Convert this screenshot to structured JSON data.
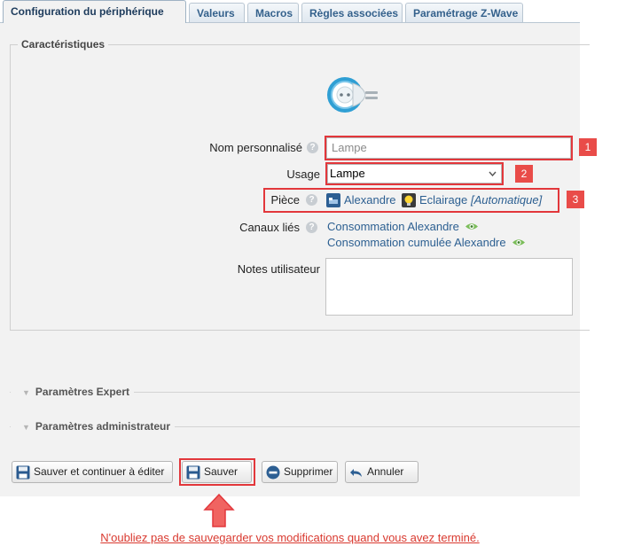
{
  "tabs": [
    {
      "label": "Configuration du périphérique",
      "active": true
    },
    {
      "label": "Valeurs"
    },
    {
      "label": "Macros"
    },
    {
      "label": "Règles associées"
    },
    {
      "label": "Paramétrage Z-Wave"
    }
  ],
  "characteristics": {
    "legend": "Caractéristiques",
    "device_icon": "plug-icon",
    "name": {
      "label": "Nom personnalisé",
      "value": "Lampe",
      "help": "?"
    },
    "usage": {
      "label": "Usage",
      "selected": "Lampe"
    },
    "room": {
      "label": "Pièce",
      "help": "?",
      "room_name": "Alexandre",
      "usage_link": "Eclairage",
      "mode": "[Automatique]"
    },
    "channels": {
      "label": "Canaux liés",
      "items": [
        "Consommation Alexandre",
        "Consommation cumulée Alexandre"
      ]
    },
    "notes": {
      "label": "Notes utilisateur",
      "value": ""
    }
  },
  "annotations": {
    "badge1": "1",
    "badge2": "2",
    "badge3": "3"
  },
  "sections": {
    "expert": "Paramètres Expert",
    "admin": "Paramètres administrateur"
  },
  "buttons": {
    "save_continue": "Sauver et continuer à éditer",
    "save": "Sauver",
    "delete": "Supprimer",
    "cancel": "Annuler"
  },
  "footer_note": "N'oubliez pas de sauvegarder vos modifications quand vous avez terminé.",
  "colors": {
    "accent_red": "#e2373b",
    "link_blue": "#2c5f91",
    "tab_text": "#34618c"
  }
}
